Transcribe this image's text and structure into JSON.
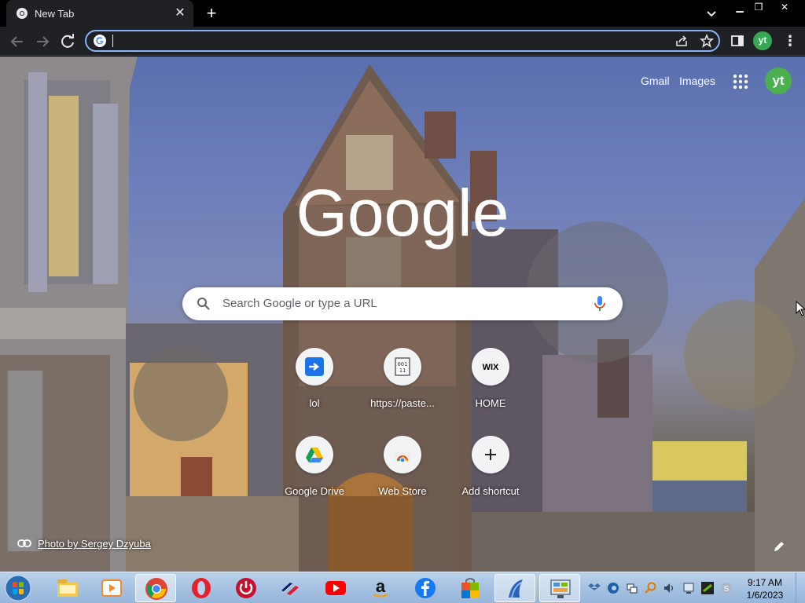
{
  "browser": {
    "tab_title": "New Tab",
    "omnibox_value": "",
    "profile_initials": "yt"
  },
  "page": {
    "gmail": "Gmail",
    "images": "Images",
    "avatar_initials": "yt",
    "logo_text": "Google",
    "search_placeholder": "Search Google or type a URL",
    "shortcuts": [
      {
        "label": "lol",
        "icon": "blue-arrow-icon"
      },
      {
        "label": "https://paste...",
        "icon": "binary-file-icon"
      },
      {
        "label": "HOME",
        "icon": "wix-icon",
        "icon_text": "WIX"
      },
      {
        "label": "Google Drive",
        "icon": "google-drive-icon"
      },
      {
        "label": "Web Store",
        "icon": "chrome-web-store-icon"
      },
      {
        "label": "Add shortcut",
        "icon": "plus-icon"
      }
    ],
    "photo_credit": "Photo by Sergey Dzyuba"
  },
  "taskbar": {
    "apps": [
      "file-explorer-icon",
      "media-player-icon",
      "chrome-icon",
      "opera-icon",
      "power-icon",
      "bank-of-america-icon",
      "youtube-icon",
      "amazon-icon",
      "facebook-icon",
      "store-bag-icon",
      "app-icon",
      "control-panel-icon"
    ],
    "time": "9:17 AM",
    "date": "1/6/2023"
  },
  "colors": {
    "accent": "#8ab4f8",
    "toolbar": "#202124",
    "profile": "#34a853"
  }
}
